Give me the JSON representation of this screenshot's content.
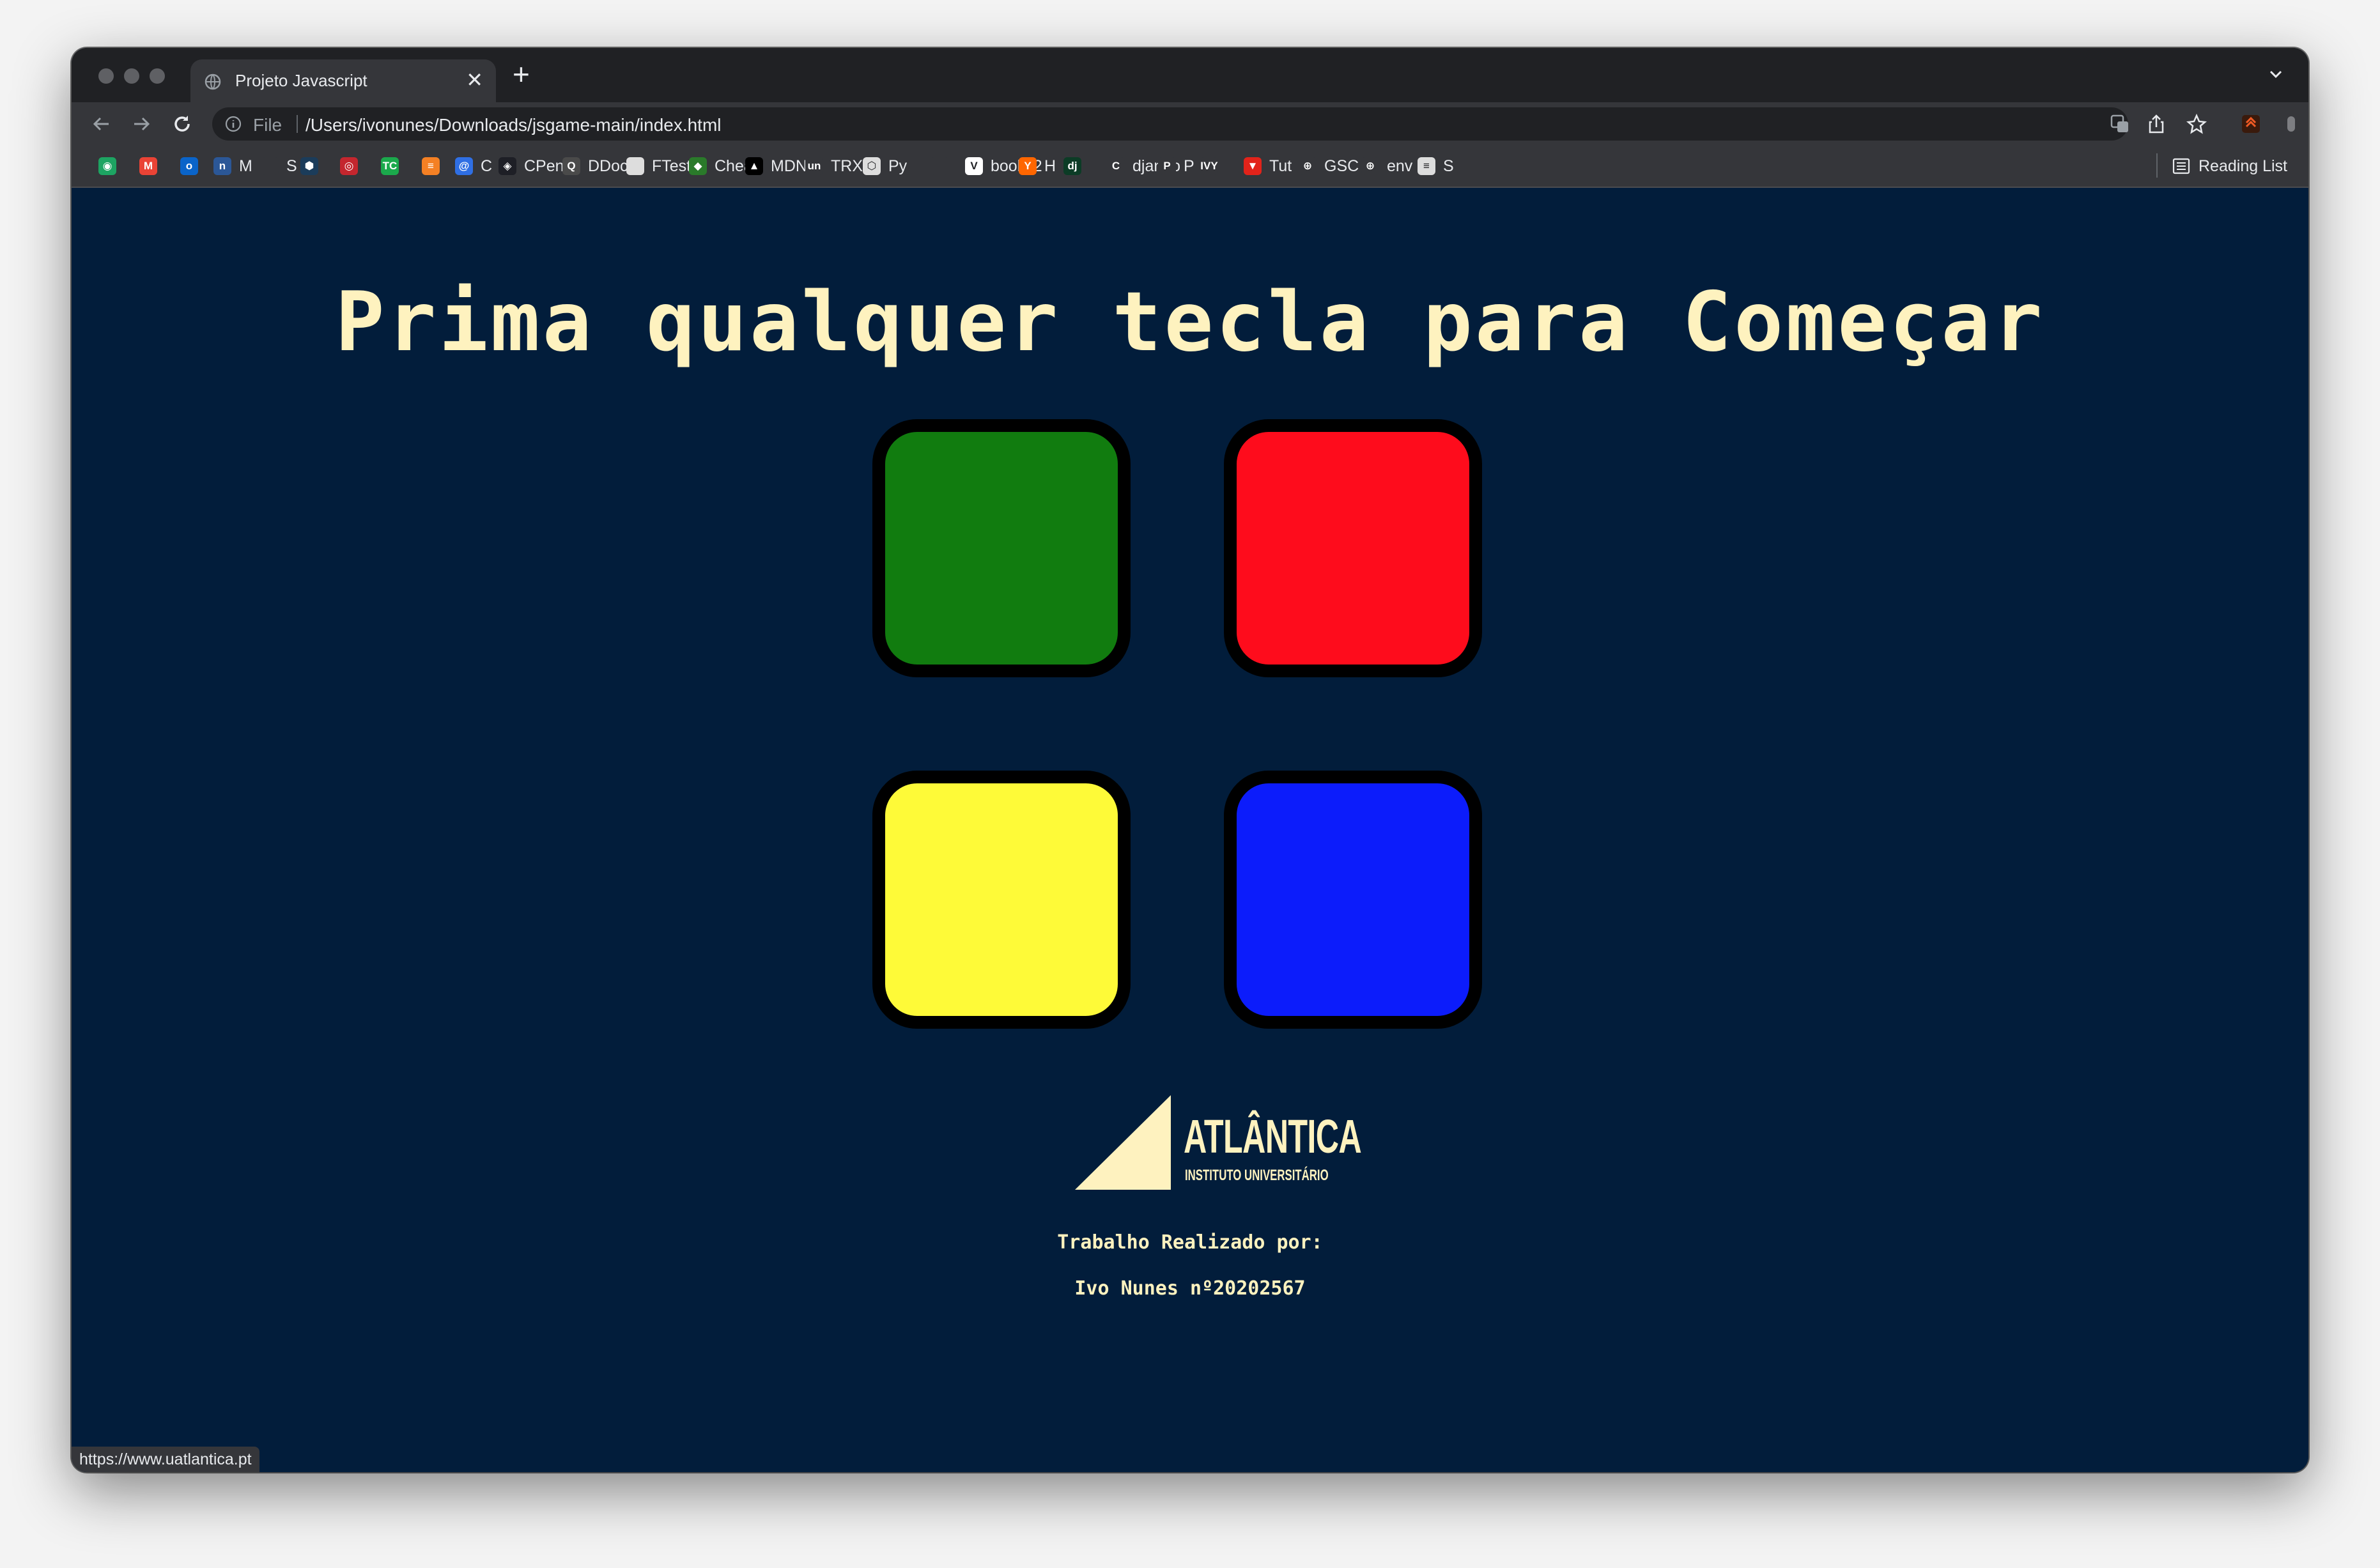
{
  "browser": {
    "tab": {
      "title": "Projeto Javascript",
      "close_glyph": "✕"
    },
    "new_tab_glyph": "+",
    "omnibox": {
      "scheme_label": "File",
      "url": "/Users/ivonunes/Downloads/jsgame-main/index.html"
    },
    "bookmarks": [
      {
        "label": "",
        "icon": "hangouts-icon",
        "color": "#1da462",
        "glyph": "◉"
      },
      {
        "label": "",
        "icon": "gmail-icon",
        "color": "#ea4335",
        "glyph": "M"
      },
      {
        "label": "",
        "icon": "outlook-icon",
        "color": "#0a64c9",
        "glyph": "o"
      },
      {
        "label": "M",
        "icon": "mlab-icon",
        "color": "#2b5797",
        "glyph": "n"
      },
      {
        "label": "S",
        "icon": "site-icon",
        "color": "#35363a",
        "glyph": ""
      },
      {
        "label": "",
        "icon": "dark-hex-icon",
        "color": "#1b3c5a",
        "glyph": "⬢"
      },
      {
        "label": "",
        "icon": "red-mask-icon",
        "color": "#c4262e",
        "glyph": "◎"
      },
      {
        "label": "",
        "icon": "tc-icon",
        "color": "#1ba94c",
        "glyph": "TC"
      },
      {
        "label": "",
        "icon": "stackoverflow-icon",
        "color": "#f48024",
        "glyph": "≡"
      },
      {
        "label": "C",
        "icon": "at-icon",
        "color": "#2f6fe4",
        "glyph": "@"
      },
      {
        "label": "CPen",
        "icon": "codepen-icon",
        "color": "#1e1f26",
        "glyph": "◈"
      },
      {
        "label": "DDocs",
        "icon": "devdocs-icon",
        "color": "#4a4a4a",
        "glyph": "Q"
      },
      {
        "label": "FTest",
        "icon": "ftest-icon",
        "color": "#dddddd",
        "glyph": ""
      },
      {
        "label": "Cheat",
        "icon": "cheat-icon",
        "color": "#2a7a2a",
        "glyph": "◆"
      },
      {
        "label": "MDN",
        "icon": "mdn-icon",
        "color": "#000000",
        "glyph": "▲"
      },
      {
        "label": "TRX",
        "icon": "unsplash-icon",
        "color": "#35363a",
        "glyph": "un"
      },
      {
        "label": "Py",
        "icon": "py-icon",
        "color": "#dddddd",
        "glyph": "⬡"
      },
      {
        "label": "",
        "icon": "blank-icon",
        "color": "#35363a",
        "glyph": ""
      },
      {
        "label": "books2",
        "icon": "books-icon",
        "color": "#ffffff",
        "glyph": "V"
      },
      {
        "label": "H",
        "icon": "hackernews-icon",
        "color": "#ff6600",
        "glyph": "Y"
      },
      {
        "label": "",
        "icon": "django-docs-icon",
        "color": "#0c3c26",
        "glyph": "dj"
      },
      {
        "label": "django",
        "icon": "django-icon",
        "color": "#35363a",
        "glyph": "C"
      },
      {
        "label": "P",
        "icon": "paypal-icon",
        "color": "#35363a",
        "glyph": "P"
      },
      {
        "label": "",
        "icon": "ivy-icon",
        "color": "#35363a",
        "glyph": "IVY"
      },
      {
        "label": "Tut",
        "icon": "tut-icon",
        "color": "#e2231a",
        "glyph": "▼"
      },
      {
        "label": "GSC",
        "icon": "globe-icon",
        "color": "#35363a",
        "glyph": "⊕"
      },
      {
        "label": "env",
        "icon": "globe-icon",
        "color": "#35363a",
        "glyph": "⊕"
      },
      {
        "label": "S",
        "icon": "s-doc-icon",
        "color": "#dddddd",
        "glyph": "≡"
      }
    ],
    "reading_list_label": "Reading List",
    "status_url": "https://www.uatlantica.pt"
  },
  "game": {
    "level_title": "Prima qualquer tecla para Começar",
    "pads": [
      {
        "id": "green",
        "color": "#117c0f"
      },
      {
        "id": "red",
        "color": "#fe0c1c"
      },
      {
        "id": "yellow",
        "color": "#fefa38"
      },
      {
        "id": "blue",
        "color": "#0c1cfb"
      }
    ]
  },
  "footer": {
    "logo_name": "ATLÂNTICA",
    "logo_subtitle": "INSTITUTO UNIVERSITÁRIO",
    "credit_heading": "Trabalho Realizado por:",
    "credit_author": "Ivo Nunes nº20202567"
  },
  "colors": {
    "page_background": "#021d3b",
    "text_cream": "#fef2bf",
    "chrome_dark": "#202124",
    "chrome_toolbar": "#35363a"
  }
}
